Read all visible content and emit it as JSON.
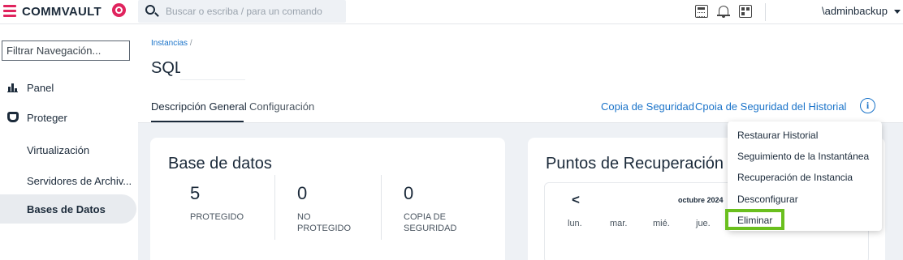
{
  "topbar": {
    "brand": "COMMVAULT",
    "search_placeholder": "Buscar o escriba / para un comando",
    "user": "\\adminbackup",
    "icons": [
      "menu-icon",
      "commvault-logo-icon",
      "search-icon",
      "calculator-icon",
      "bell-icon",
      "grid-icon",
      "chevron-down-icon"
    ]
  },
  "sidebar": {
    "filter_placeholder": "Filtrar Navegación...",
    "items": [
      {
        "label": "Panel",
        "icon": "dashboard-chart-icon"
      },
      {
        "label": "Proteger",
        "icon": "shield-icon"
      },
      {
        "label": "Virtualización"
      },
      {
        "label": "Servidores de Archiv..."
      },
      {
        "label": "Bases de Datos",
        "active": true
      }
    ]
  },
  "header": {
    "breadcrumb": "Instancias",
    "breadcrumb_sep": "/",
    "title": "SQL",
    "tabs": [
      {
        "label": "Descripción General",
        "active": true
      },
      {
        "label": "Configuración"
      }
    ],
    "actions": [
      "Copia de Seguridad",
      "Cpoia de Seguridad del Historial"
    ],
    "info_glyph": "i"
  },
  "database_card": {
    "title": "Base de datos",
    "stats": [
      {
        "value": "5",
        "label": "PROTEGIDO"
      },
      {
        "value": "0",
        "label": "NO PROTEGIDO"
      },
      {
        "value": "0",
        "label": "COPIA DE SEGURIDAD"
      }
    ]
  },
  "recovery_card": {
    "title": "Puntos de Recuperación",
    "calendar": {
      "prev": "<",
      "month": "octubre 2024",
      "weekdays": [
        "lun.",
        "mar.",
        "mié.",
        "jue."
      ]
    }
  },
  "menu": {
    "items": [
      "Restaurar Historial",
      "Seguimiento de la Instantánea",
      "Recuperación de Instancia",
      "Desconfigurar",
      "Eliminar"
    ],
    "highlighted": "Eliminar",
    "highlight_color": "#6abf1e"
  },
  "colors": {
    "accent": "#e0245e",
    "link": "#1a73c9",
    "background": "#eef1f5"
  }
}
